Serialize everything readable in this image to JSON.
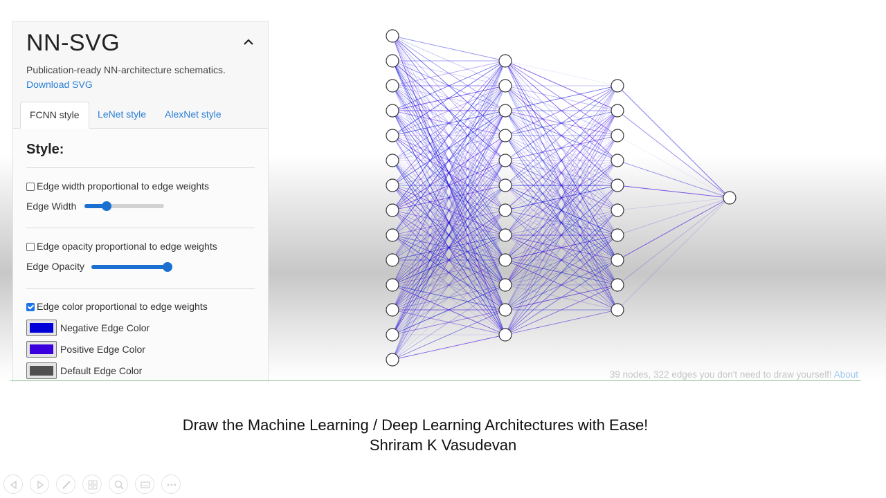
{
  "panel": {
    "title": "NN-SVG",
    "subtitle": "Publication-ready NN-architecture schematics.",
    "download_link": "Download SVG",
    "tabs": [
      {
        "label": "FCNN style",
        "active": true
      },
      {
        "label": "LeNet style",
        "active": false
      },
      {
        "label": "AlexNet style",
        "active": false
      }
    ],
    "style_heading": "Style:",
    "edge_width_checkbox": "Edge width proportional to edge weights",
    "edge_width_checked": false,
    "edge_width_label": "Edge Width",
    "edge_width_value": 0.28,
    "edge_opacity_checkbox": "Edge opacity proportional to edge weights",
    "edge_opacity_checked": false,
    "edge_opacity_label": "Edge Opacity",
    "edge_opacity_value": 0.95,
    "edge_color_checkbox": "Edge color proportional to edge weights",
    "edge_color_checked": true,
    "negative_edge_label": "Negative Edge Color",
    "positive_edge_label": "Positive Edge Color",
    "default_edge_label": "Default Edge Color",
    "colors": {
      "negative": "#0000d8",
      "positive": "#3a00dd",
      "default": "#505050",
      "accent": "#1a6fd0",
      "link": "#2a7fd4"
    }
  },
  "network": {
    "layers": [
      14,
      12,
      10,
      1
    ],
    "stats_text": "39 nodes, 322 edges you don't need to draw yourself!",
    "about_link": "About"
  },
  "caption": {
    "line1": "Draw the Machine Learning / Deep Learning Architectures with Ease!",
    "line2": "Shriram K Vasudevan"
  },
  "toolbar": {
    "buttons": [
      "previous-icon",
      "next-icon",
      "pen-icon",
      "slides-icon",
      "zoom-icon",
      "subtitles-icon",
      "more-icon"
    ]
  }
}
